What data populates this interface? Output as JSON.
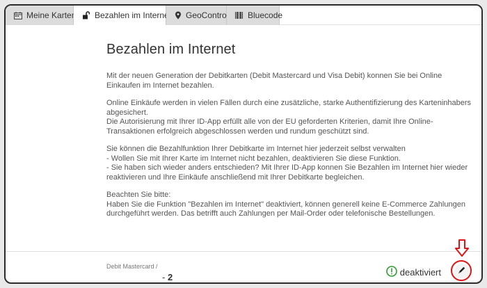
{
  "tabs": [
    {
      "label": "Meine Karten",
      "icon": "calendar-card-icon",
      "active": false
    },
    {
      "label": "Bezahlen im Internet",
      "icon": "unlock-icon",
      "active": true
    },
    {
      "label": "GeoControl",
      "icon": "map-pin-icon",
      "active": false
    },
    {
      "label": "Bluecode",
      "icon": "barcode-icon",
      "active": false
    }
  ],
  "page": {
    "title": "Bezahlen im Internet",
    "paragraphs": [
      [
        "Mit der neuen Generation der Debitkarten (Debit Mastercard und Visa Debit) konnen Sie bei Online Einkaufen im Internet bezahlen."
      ],
      [
        "Online Einkäufe werden in vielen Fällen durch eine zusätzliche, starke Authentifizierung des Karteninhabers abgesichert.",
        "Die Autorisierung mit Ihrer ID-App erfüllt alle von der EU geforderten Kriterien, damit Ihre Online-Transaktionen erfolgreich abgeschlossen werden und rundum geschützt sind."
      ],
      [
        "Sie können die Bezahlfunktion Ihrer Debitkarte im Internet hier jederzeit selbst verwalten",
        "- Wollen Sie mit Ihrer Karte im Internet nicht bezahlen, deaktivieren Sie diese Funktion.",
        "- Sie haben sich wieder anders entschieden? Mit Ihrer ID-App konnen Sie Bezahlen im Internet hier wieder reaktivieren und Ihre Einkäufe anschließend mit Ihrer Debitkarte begleichen."
      ],
      [
        "Beachten Sie bitte:",
        "Haben Sie die Funktion \"Bezahlen im Internet\" deaktiviert, können generell keine E-Commerce Zahlungen durchgeführt werden. Das betrifft auch Zahlungen per Mail-Order oder telefonische Bestellungen."
      ]
    ]
  },
  "card": {
    "type": "Debit Mastercard /",
    "number_prefix": "- ",
    "number": "2",
    "status": "deaktiviert",
    "status_icon": "exclamation-circle-icon",
    "edit_icon": "pencil-icon"
  },
  "colors": {
    "tab_inactive": "#dcdcdc",
    "status_green": "#2e9d2e",
    "highlight_red": "#e01414"
  }
}
